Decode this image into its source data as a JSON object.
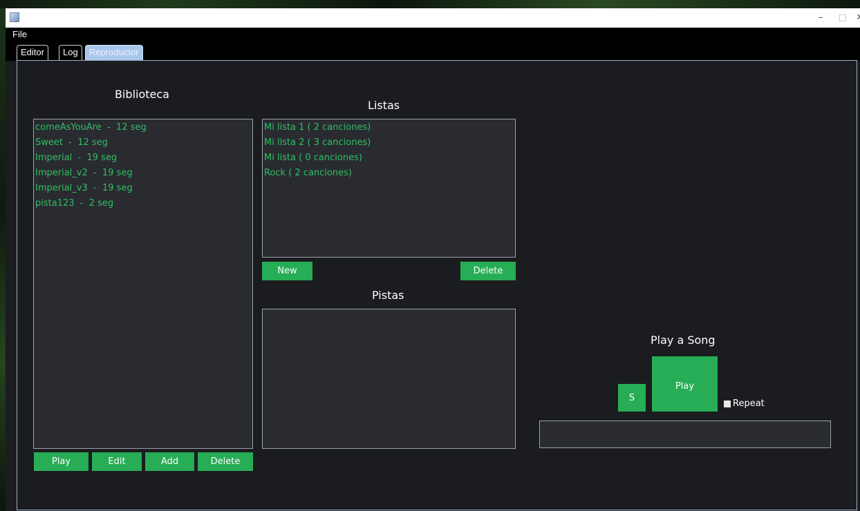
{
  "window": {
    "title": "",
    "controls": {
      "minimize": "–",
      "maximize": "□",
      "close": "✕"
    }
  },
  "menu": {
    "file": "File"
  },
  "tabs": [
    "Editor",
    "Log",
    "Reproductor"
  ],
  "selected_tab": "Reproductor",
  "biblioteca": {
    "title": "Biblioteca",
    "items": [
      "comeAsYouAre  -  12 seg",
      "Sweet  -  12 seg",
      "Imperial  -  19 seg",
      "Imperial_v2  -  19 seg",
      "Imperial_v3  -  19 seg",
      "pista123  -  2 seg"
    ],
    "buttons": {
      "play": "Play",
      "edit": "Edit",
      "add": "Add",
      "delete": "Delete"
    }
  },
  "listas": {
    "title": "Listas",
    "items": [
      "Mi lista 1 ( 2 canciones)",
      "Mi lista 2 ( 3 canciones)",
      "Mi lista ( 0 canciones)",
      "Rock ( 2 canciones)"
    ],
    "buttons": {
      "new": "New",
      "delete": "Delete"
    }
  },
  "pistas": {
    "title": "Pistas",
    "items": []
  },
  "player": {
    "title": "Play a Song",
    "stop_label": "S",
    "play_label": "Play",
    "repeat_label": "Repeat",
    "repeat_checked": false
  },
  "colors": {
    "accent_green": "#26ad55",
    "list_text": "#2fbf61",
    "background": "#1b1c1f",
    "list_bg": "#292b31"
  }
}
